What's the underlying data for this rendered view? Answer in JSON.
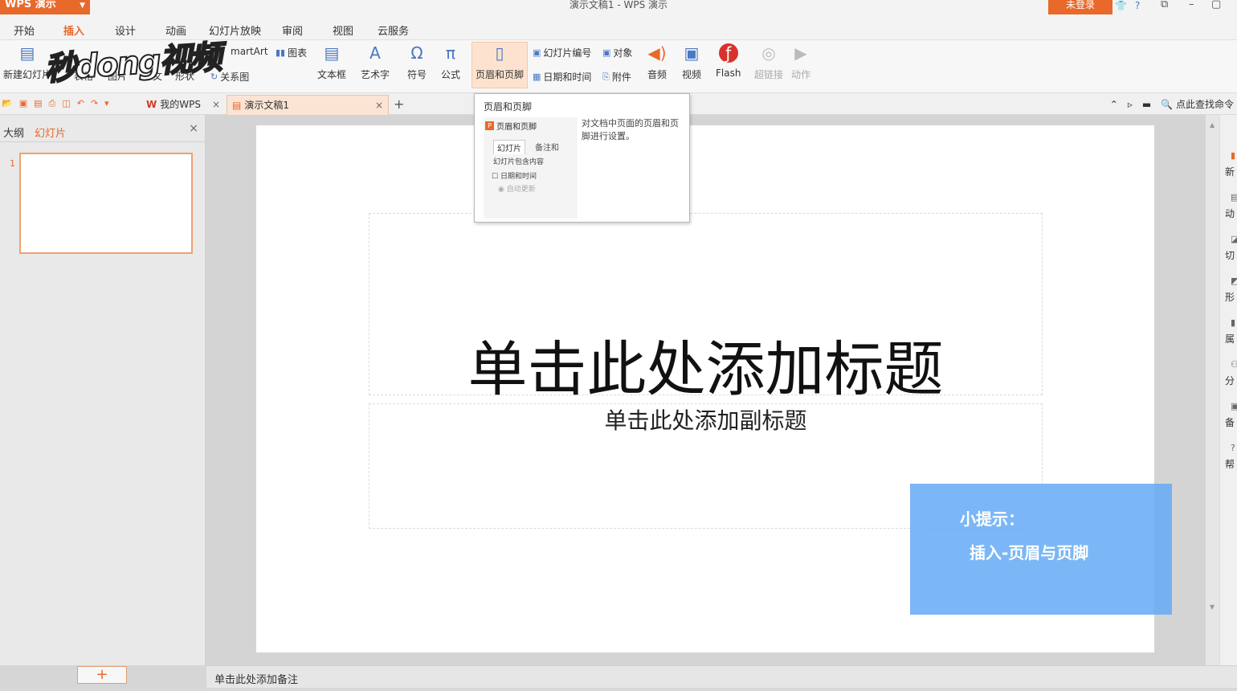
{
  "titlebar": {
    "app_name": "WPS 演示",
    "doc_title": "演示文稿1 - WPS 演示",
    "login": "未登录"
  },
  "menu": {
    "tabs": [
      "开始",
      "插入",
      "设计",
      "动画",
      "幻灯片放映",
      "审阅",
      "视图",
      "云服务"
    ],
    "active": "插入"
  },
  "ribbon": {
    "new_slide": "新建幻灯片",
    "table": "表格",
    "picture": "图片",
    "shape_prefix": "文",
    "shape": "形状",
    "smartart": "martArt",
    "chart": "图表",
    "relation": "关系图",
    "textbox": "文本框",
    "wordart": "艺术字",
    "symbol": "符号",
    "formula": "公式",
    "header_footer": "页眉和页脚",
    "slide_number": "幻灯片编号",
    "object": "对象",
    "date_time": "日期和时间",
    "attachment": "附件",
    "audio": "音频",
    "video": "视频",
    "flash": "Flash",
    "hyperlink": "超链接",
    "action": "动作"
  },
  "watermark": "秒dong视频",
  "doctabs": {
    "my_wps": "我的WPS",
    "current_doc": "演示文稿1",
    "search_cmd": "点此查找命令"
  },
  "leftpanel": {
    "tab_outline": "大纲",
    "tab_slides": "幻灯片",
    "slide_number": "1",
    "add": "+"
  },
  "slide": {
    "title_placeholder": "单击此处添加标题",
    "subtitle_placeholder": "单击此处添加副标题"
  },
  "tooltip": {
    "title": "页眉和页脚",
    "description": "对文档中页面的页眉和页脚进行设置。",
    "preview_heading": "页眉和页脚",
    "preview_tab1": "幻灯片",
    "preview_tab2": "备注和",
    "preview_group": "幻灯片包含内容",
    "preview_checkbox": "日期和时间",
    "preview_radio": "自动更新"
  },
  "tip": {
    "title": "小提示：",
    "body": "插入-页眉与页脚"
  },
  "notes": {
    "placeholder": "单击此处添加备注"
  },
  "rightrail": [
    "新",
    "动",
    "切",
    "形",
    "属",
    "分",
    "备",
    "帮"
  ],
  "colors": {
    "accent": "#e8692a",
    "tip_bg": "#64aaf5",
    "hover": "#fde3cf"
  }
}
